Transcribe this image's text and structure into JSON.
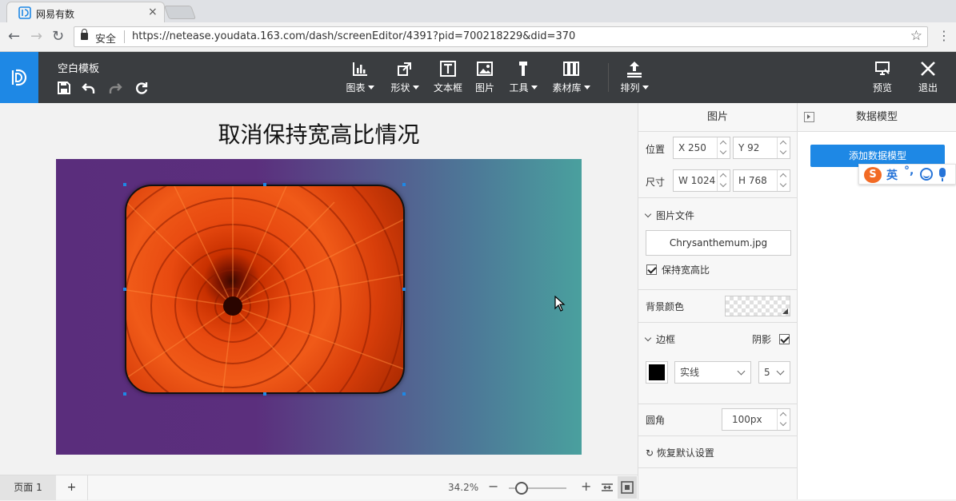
{
  "browser": {
    "tab_title": "网易有数",
    "tab_close": "×",
    "secure_label": "安全",
    "url": "https://netease.youdata.163.com/dash/screenEditor/4391?pid=700218229&did=370"
  },
  "toolbar": {
    "template_name": "空白模板",
    "tools": [
      {
        "label": "图表",
        "icon": "bar-chart-icon",
        "dropdown": true
      },
      {
        "label": "形状",
        "icon": "shape-icon",
        "dropdown": true
      },
      {
        "label": "文本框",
        "icon": "textbox-icon",
        "dropdown": false
      },
      {
        "label": "图片",
        "icon": "image-icon",
        "dropdown": false
      },
      {
        "label": "工具",
        "icon": "tools-icon",
        "dropdown": true
      },
      {
        "label": "素材库",
        "icon": "library-icon",
        "dropdown": true
      },
      {
        "label": "排列",
        "icon": "arrange-icon",
        "dropdown": true
      }
    ],
    "preview_label": "预览",
    "exit_label": "退出"
  },
  "canvas": {
    "title": "取消保持宽高比情况"
  },
  "bottom": {
    "page_tab": "页面 1",
    "add_page": "+",
    "zoom": "34.2%",
    "zoom_minus": "−",
    "zoom_plus": "+"
  },
  "props": {
    "title": "图片",
    "position_label": "位置",
    "x_value": "X 250",
    "y_value": "Y 92",
    "size_label": "尺寸",
    "w_value": "W 1024",
    "h_value": "H 768",
    "image_file_label": "图片文件",
    "file_name": "Chrysanthemum.jpg",
    "keep_ratio_label": "保持宽高比",
    "keep_ratio_checked": true,
    "bg_color_label": "背景颜色",
    "border_label": "边框",
    "shadow_label": "阴影",
    "shadow_checked": true,
    "border_style": "实线",
    "border_width": "5",
    "radius_label": "圆角",
    "radius_value": "100px",
    "reset_label": "恢复默认设置"
  },
  "model": {
    "title": "数据模型",
    "add_button": "添加数据模型"
  },
  "ime": {
    "brand": "S",
    "language": "英",
    "punct": "°,"
  },
  "colors": {
    "accent": "#1e88e5",
    "toolbar_bg": "#3a3d40"
  }
}
